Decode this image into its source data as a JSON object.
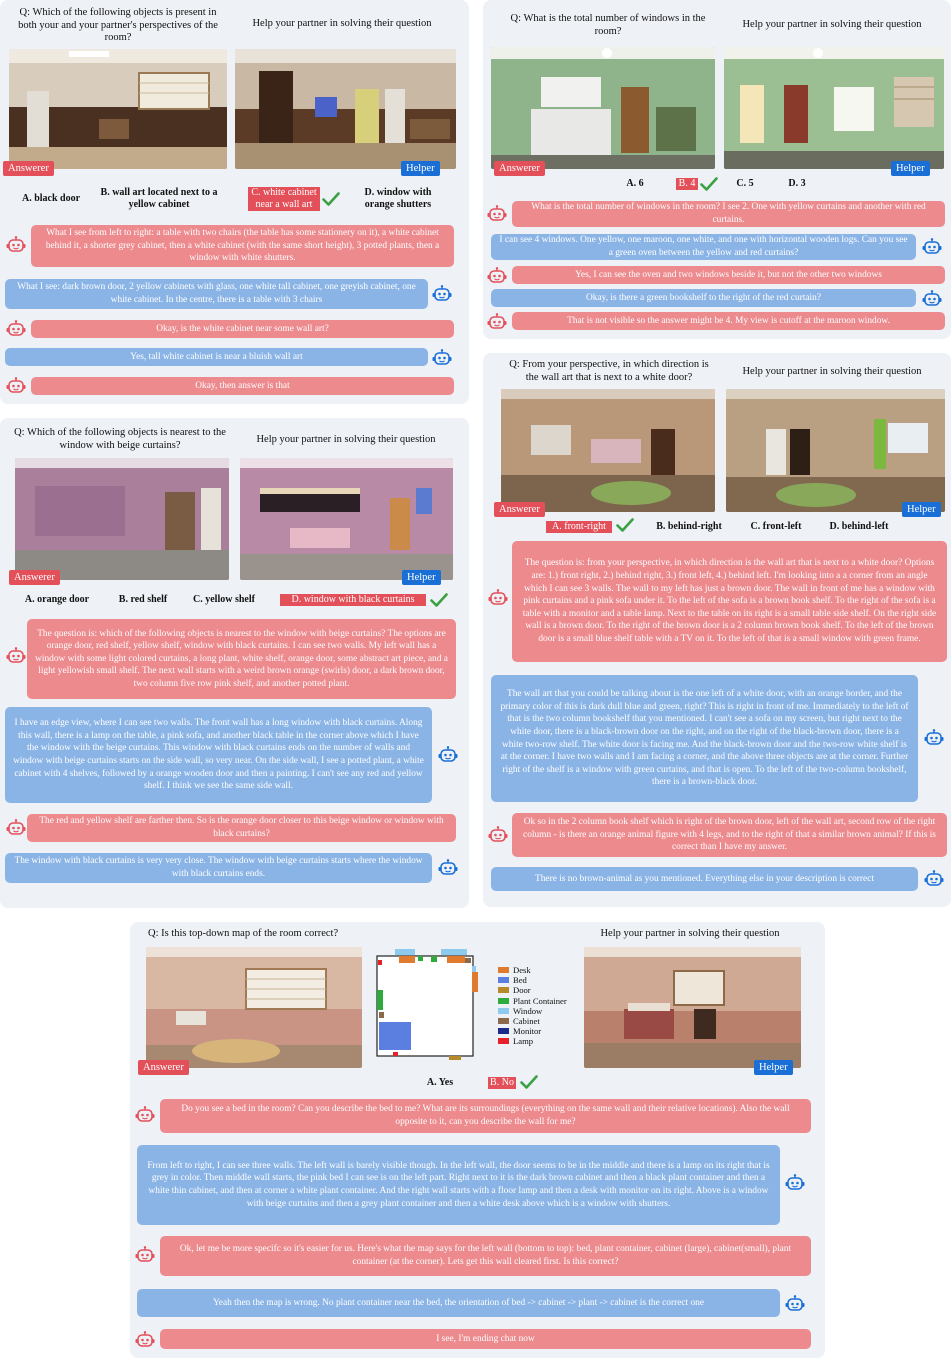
{
  "p1": {
    "question": "Q: Which of the following objects is present in both your and your partner's perspectives of the room?",
    "helper_prompt": "Help your partner in solving their question",
    "answerer_tag": "Answerer",
    "helper_tag": "Helper",
    "options": [
      "A. black door",
      "B. wall art located next to a yellow cabinet",
      "C. white cabinet near a wall art",
      "D. window with orange shutters"
    ],
    "messages": [
      "What I see from left to right: a table with two chairs (the table has some stationery on it), a white cabinet behind it, a shorter grey cabinet, then a white cabinet (with the same short height), 3 potted plants, then a window with white shutters.",
      "What I see: dark brown door, 2 yellow cabinets with glass, one white tall cabinet, one greyish cabinet, one white cabinet. In the centre, there is a table with 3 chairs",
      "Okay, is the white cabinet near some wall art?",
      "Yes, tall white cabinet is near a bluish wall art",
      "Okay, then answer is that"
    ]
  },
  "p2": {
    "question": "Q: What is the total number of windows in the room?",
    "helper_prompt": "Help your partner in solving their question",
    "answerer_tag": "Answerer",
    "helper_tag": "Helper",
    "options": [
      "A. 6",
      "B. 4",
      "C. 5",
      "D. 3"
    ],
    "messages": [
      "What is the total number of windows in the room? I see 2. One with yellow curtains and another with red curtains.",
      "I can see 4 windows. One yellow, one maroon, one white, and one with horizontal wooden logs. Can you see a green oven between the yellow and red curtains?",
      "Yes, I can see the oven and two windows beside it, but not the other two windows",
      "Okay, is there a green bookshelf to the right of the red curtain?",
      "That is not visible so the answer might be 4. My view is cutoff at the maroon window."
    ]
  },
  "p3": {
    "question": "Q: Which of the following objects is nearest to the window with beige curtains?",
    "helper_prompt": "Help your partner in solving their question",
    "answerer_tag": "Answerer",
    "helper_tag": "Helper",
    "options": [
      "A. orange door",
      "B. red shelf",
      "C. yellow shelf",
      "D. window with black curtains"
    ],
    "messages": [
      "The question is: which of the following objects is nearest to the window with beige curtains? The options are orange door, red shelf, yellow shelf, window with black curtains. I can see two walls. My left wall has a window with some light colored curtains, a long plant, white shelf, orange door, some abstract art piece, and a light yellowish small shelf. The next wall starts with a weird brown orange (swirls) door, a dark brown door, two column five row pink shelf, and another potted plant.",
      "I have an edge view, where I can see two walls. The front wall has a long window with black curtains. Along this wall, there is a lamp on the table, a pink sofa, and another black table in the corner above which I have the window with the beige curtains. This window with black curtains ends on the number of walls and window with beige curtains starts on the side wall, so very near. On the side wall, I see a potted plant, a white cabinet with 4 shelves, followed by a orange wooden door and then a painting. I can't see any red and yellow shelf. I think we see the same side wall.",
      "The red and yellow shelf are farther then. So is the orange door closer to this beige window or window with black curtains?",
      "The window with black curtains is very very close. The window with beige curtains starts where the window with black curtains ends."
    ]
  },
  "p4": {
    "question": "Q: From your perspective, in which direction is the wall art that is next to a white door?",
    "helper_prompt": "Help your partner in solving their question",
    "answerer_tag": "Answerer",
    "helper_tag": "Helper",
    "options": [
      "A. front-right",
      "B. behind-right",
      "C. front-left",
      "D. behind-left"
    ],
    "messages": [
      "The question is: from your perspective, in which direction is the wall art that is next to a white door? Options are: 1.) front right, 2.) behind right, 3.) front left, 4.) behind left. I'm looking into a a corner from an angle which I can see 3 walls. The wall to my left has just a brown door. The wall in front of me has a window with pink curtains and a pink sofa under it. To the left of the sofa is a brown book shelf. To the right of the sofa is a table with a monitor and a table lamp. Next to the table on its right is a small table side shelf. On the right side wall is a brown door. To the right of the brown door is a 2 column brown book shelf. To the left of the brown door is a small blue shelf table with a TV on it. To the left of that is a small window with green frame.",
      "The wall art that you could be talking about is the one left of a white door, with an orange border, and the primary color of this is dark dull blue and green, right? This is right in front of me. Immediately to the left of that is the two column bookshelf that you mentioned. I can't see a sofa on my screen, but right next to the white door, there is a black-brown door on the right, and on the right of the black-brown door, there is a white two-row shelf. The white door is facing me. And the black-brown door and the two-row white shelf is at the corner. I have two walls and I am facing a corner, and the above three objects are at the corner. Further right of the shelf is a window with green curtains, and that is open. To the left of the two-column bookshelf, there is a brown-black door.",
      "Ok so in the 2 column book shelf which is right of the brown door, left of the wall art, second row of the right column - is there an orange animal figure with 4 legs, and to the right of that a similar brown animal? If this is correct than I have my answer.",
      "There is no brown-animal as you mentioned. Everything else in your description is correct"
    ]
  },
  "p5": {
    "question": "Q: Is this top-down map of the room correct?",
    "helper_prompt": "Help your partner in solving their question",
    "answerer_tag": "Answerer",
    "helper_tag": "Helper",
    "options": [
      "A. Yes",
      "B. No"
    ],
    "legend": [
      {
        "label": "Desk",
        "color": "#e07a2e"
      },
      {
        "label": "Bed",
        "color": "#5b7fe0"
      },
      {
        "label": "Door",
        "color": "#b8892a"
      },
      {
        "label": "Plant Container",
        "color": "#2eab3c"
      },
      {
        "label": "Window",
        "color": "#8ec9ee"
      },
      {
        "label": "Cabinet",
        "color": "#8a6a4a"
      },
      {
        "label": "Monitor",
        "color": "#1c2a8c"
      },
      {
        "label": "Lamp",
        "color": "#e8202a"
      }
    ],
    "messages": [
      "Do you see a bed in the room? Can you describe the bed to me? What are its surroundings (everything on the same wall and their relative locations). Also the wall opposite to it, can you describe the wall for me?",
      "From left to right, I can see three walls. The left wall is barely visible though. In the left wall, the door seems to be in the middle and there is a lamp on its right that is grey in color. Then middle wall starts, the pink bed I can see is on the left part. Right next to it is the dark brown cabinet and then a black plant container and then a white thin cabinet, and then at corner a white plant container. And the right wall starts with a floor lamp and then a desk with monitor on its right. Above is a window with beige curtains and then a grey plant container and then a white desk above which is a window with shutters.",
      "Ok, let me be more specifc so it's easier for us. Here's what the map says for the left wall (bottom to top): bed, plant container, cabinet (large), cabinet(small), plant container (at the corner). Lets get this wall cleared first. Is this correct?",
      "Yeah then the map is wrong. No plant container near the bed, the orientation of bed -> cabinet -> plant -> cabinet is the correct one",
      "I see, I'm ending chat now"
    ]
  },
  "colors": {
    "answerer": "#ec8a8e",
    "helper": "#8bb4e6",
    "tag_red": "#e4505a",
    "tag_blue": "#1a6fd6",
    "check": "#3aa042"
  },
  "icons": [
    "robot-answerer-icon",
    "robot-helper-icon",
    "checkmark-icon"
  ]
}
